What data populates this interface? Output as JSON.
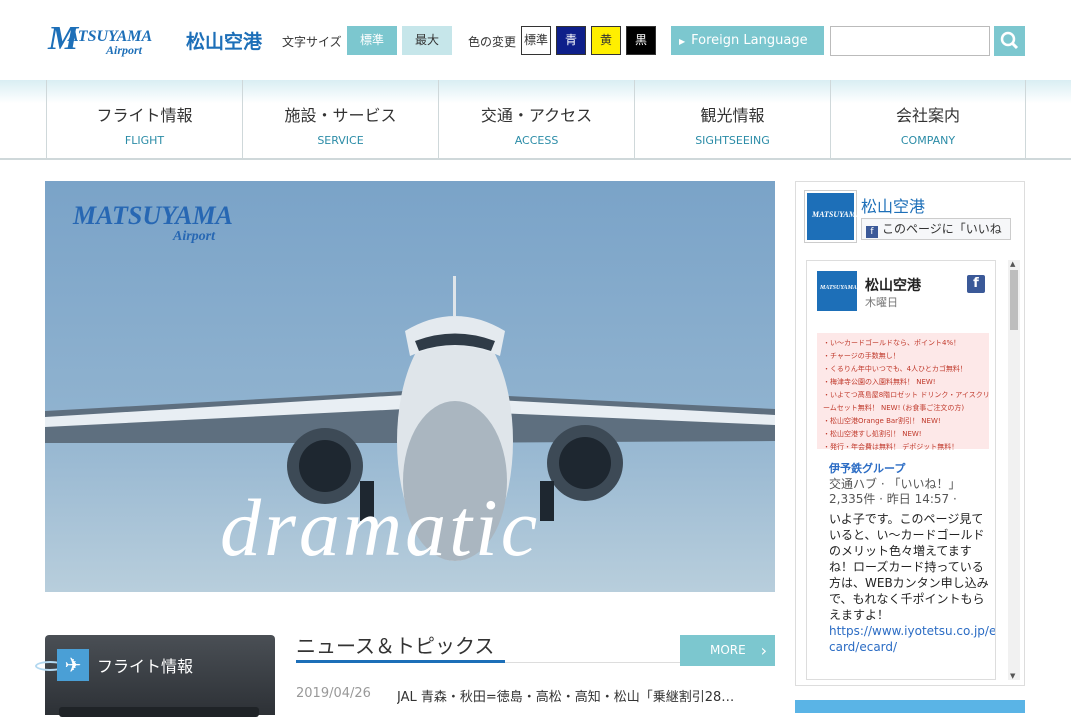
{
  "header": {
    "logo_text": "MATSUYAMA",
    "logo_m": "M",
    "logo_rest": "ATSUYAMA",
    "logo_sub": "Airport",
    "logo_jp": "松山空港",
    "text_size_label": "文字サイズ",
    "size_standard": "標準",
    "size_max": "最大",
    "color_label": "色の変更",
    "color_standard": "標準",
    "color_blue": "青",
    "color_yellow": "黄",
    "color_black": "黒",
    "foreign_language": "Foreign Language",
    "search_placeholder": ""
  },
  "nav": [
    {
      "jp": "フライト情報",
      "en": "FLIGHT"
    },
    {
      "jp": "施設・サービス",
      "en": "SERVICE"
    },
    {
      "jp": "交通・アクセス",
      "en": "ACCESS"
    },
    {
      "jp": "観光情報",
      "en": "SIGHTSEEING"
    },
    {
      "jp": "会社案内",
      "en": "COMPANY"
    }
  ],
  "hero": {
    "logo_main": "MATSUYAMA",
    "logo_sub": "Airport",
    "caption": "dramatic"
  },
  "flight_panel": {
    "title": "フライト情報"
  },
  "news": {
    "title": "ニュース＆トピックス",
    "more": "MORE",
    "items": [
      {
        "date": "2019/04/26",
        "text": "JAL 青森・秋田=徳島・高松・高知・松山「乗継割引28…"
      }
    ]
  },
  "facebook": {
    "page_name": "松山空港",
    "like_label": "このページに「いいね",
    "post": {
      "author": "松山空港",
      "day": "木曜日",
      "ad_lines": [
        "・い〜カードゴールドなら、ポイント4%！",
        "・チャージの手数無し！",
        "・くるりん年中いつでも、4人ひとカゴ無料！",
        "・梅津寺公園の入園料無料！ NEW!",
        "・いよてつ髙島屋8階ロゼット ドリンク・アイスクリ",
        "ームセット無料！ NEW! (お食事ご注文の方)",
        "・松山空港Orange Bar割引！ NEW!",
        "・松山空港すし処割引！ NEW!",
        "・発行・年会費は無料！ デポジット無料！"
      ],
      "group": "伊予鉄グループ",
      "group_sub": "交通ハブ · 「いいね！」",
      "group_meta": "2,335件 · 昨日 14:57 ·",
      "body": "いよ子です。このページ見ていると、い〜カードゴールドのメリット色々増えてますね！ローズカード持っている方は、WEBカンタン申し込みで、もれなく千ポイントもらえますよ！",
      "link": "https://www.iyotetsu.co.jp/e-card/ecard/"
    }
  }
}
